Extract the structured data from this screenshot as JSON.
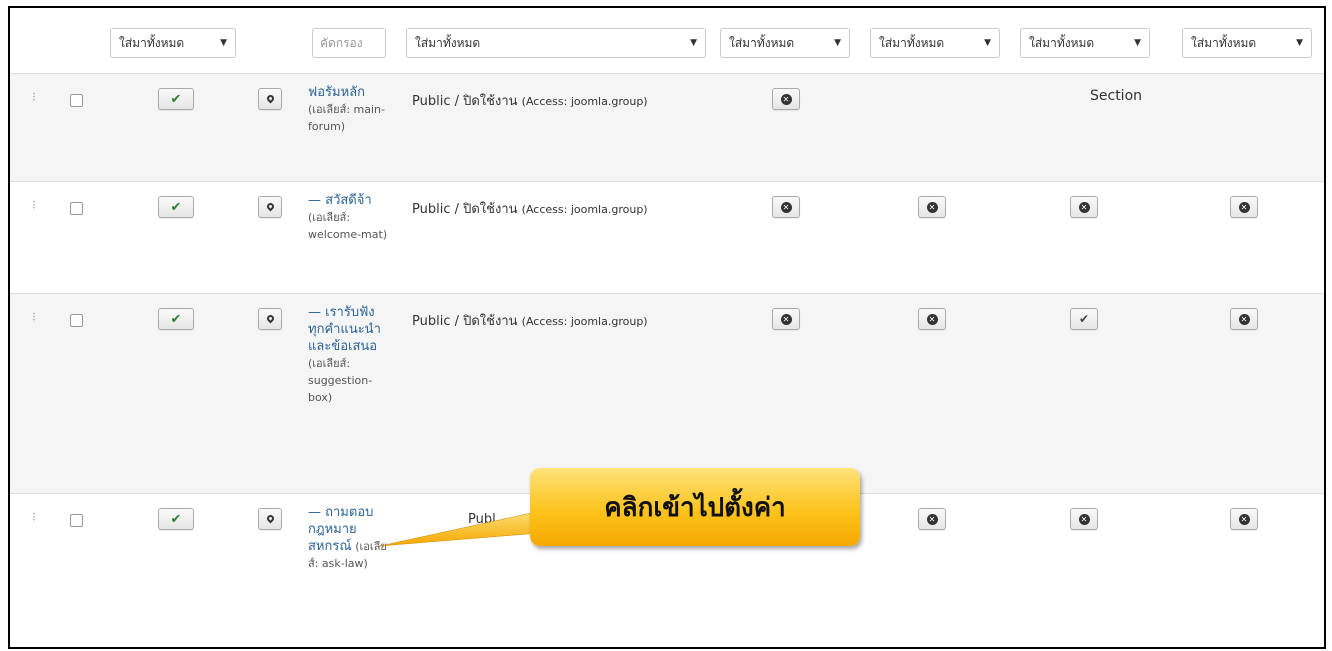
{
  "filters": {
    "status": "ใส่มาทั้งหมด",
    "search_placeholder": "คัดกรอง",
    "access": "ใส่มาทั้งหมด",
    "col1": "ใส่มาทั้งหมด",
    "col2": "ใส่มาทั้งหมด",
    "col3": "ใส่มาทั้งหมด",
    "col4": "ใส่มาทั้งหมด",
    "arrow": "▼"
  },
  "rows": [
    {
      "title": "ฟอรัมหลัก",
      "alias": "(เอเลียส์: main-forum)",
      "access_main": "Public / ปิดใช้งาน",
      "access_small": "(Access: joomla.group)",
      "section": "Section"
    },
    {
      "title": "— สวัสดีจ้า",
      "alias": "(เอเลียส์: welcome-mat)",
      "access_main": "Public / ปิดใช้งาน",
      "access_small": "(Access: joomla.group)"
    },
    {
      "title": "— เรารับฟังทุกคำแนะนำและข้อเสนอ",
      "alias": "(เอเลียส์: suggestion-box)",
      "access_main": "Public / ปิดใช้งาน",
      "access_small": "(Access: joomla.group)"
    },
    {
      "title": "— ถามตอบกฎหมายสหกรณ์",
      "alias": "(เอเลียส์: ask-law)",
      "access_partial": "Publ"
    }
  ],
  "callout": {
    "text": "คลิกเข้าไปตั้งค่า",
    "color": "#fcc41d"
  },
  "icons": {
    "check": "✔",
    "times": "✕"
  }
}
